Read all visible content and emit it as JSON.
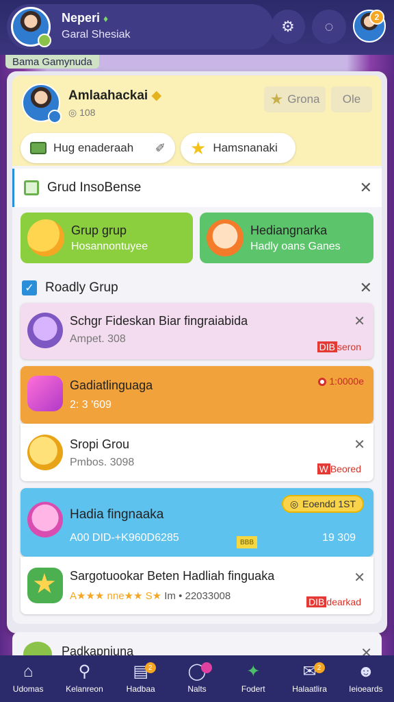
{
  "header": {
    "user_name": "Neperi",
    "user_sub": "Garal Shesiak",
    "peer_badge": "2"
  },
  "strip_label": "Bama Gamynuda",
  "profile": {
    "name": "Amlaahackai",
    "stats": "◎ 108",
    "grona_label": "Grona",
    "ole_label": "Ole",
    "chip1_label": "Hug enaderaah",
    "chip2_label": "Hamsnanaki"
  },
  "section1": {
    "title": "Grud InsoBense",
    "tile1_title": "Grup grup",
    "tile1_sub": "Hosannontuyee",
    "tile2_title": "Hediangnarka",
    "tile2_sub": "Hadly oans Ganes"
  },
  "section2": {
    "title": "Roadly Grup",
    "rows": [
      {
        "title": "Schgr Fideskan Biar fingraiabida",
        "sub": "Ampet. 308",
        "tag": "seron",
        "tag_box": "DIB"
      },
      {
        "title": "Gadiatlinguaga",
        "sub": "2: 3 '609",
        "tag": "1:0000e"
      },
      {
        "title": "Sropi Grou",
        "sub": "Pmbos. 3098",
        "tag": "Beored",
        "tag_box": "W"
      },
      {
        "title": "Hadia fingnaaka",
        "sub": "A00 DID-+K960D6285",
        "pill": "Eoendd 1ST",
        "mini_tag": "BBB",
        "count": "19 309"
      },
      {
        "title": "Sargotuookar Beten Hadliah finguaka",
        "sub_stars": "A★★★ nne★★ S★",
        "sub": "Im • 22033008",
        "tag": "dearkad",
        "tag_box": "DIB"
      }
    ]
  },
  "peek": {
    "title": "Padkapniuna"
  },
  "nav": [
    {
      "icon": "home-icon",
      "label": "Udomas"
    },
    {
      "icon": "search-icon",
      "label": "Kelanreon"
    },
    {
      "icon": "inbox-icon",
      "label": "Hadbaa",
      "badge": "2"
    },
    {
      "icon": "bubble-icon",
      "label": "Nalts",
      "badge": ""
    },
    {
      "icon": "leaf-icon",
      "label": "Fodert"
    },
    {
      "icon": "mail-icon",
      "label": "Halaatlira",
      "badge": "2"
    },
    {
      "icon": "user-icon",
      "label": "Ieioeards"
    }
  ],
  "colors": {
    "header": "#2b2a6a",
    "profile_bg": "#fbf1b6",
    "orange_row": "#f2a23a",
    "blue_row": "#5ec2ef",
    "tile_green": "#8bcf3f",
    "tile_green2": "#5cc56b"
  }
}
